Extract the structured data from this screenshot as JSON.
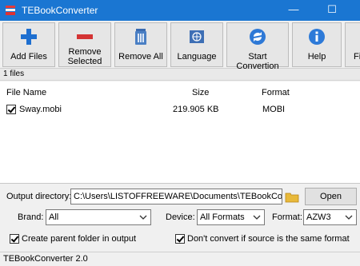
{
  "window": {
    "title": "TEBookConverter"
  },
  "toolbar": {
    "buttons": [
      {
        "label": "Add Files",
        "icon": "plus-icon"
      },
      {
        "label": "Remove\nSelected",
        "icon": "minus-icon"
      },
      {
        "label": "Remove All",
        "icon": "trash-icon"
      },
      {
        "label": "Language",
        "icon": "globe-icon"
      },
      {
        "label": "Start Convertion",
        "icon": "convert-icon"
      },
      {
        "label": "Help",
        "icon": "info-icon"
      },
      {
        "label": "Fi",
        "icon": ""
      }
    ]
  },
  "files": {
    "count_label": "1 files",
    "columns": [
      "File Name",
      "Size",
      "Format"
    ],
    "rows": [
      {
        "checked": true,
        "name": "Sway.mobi",
        "size": "219.905 KB",
        "format": "MOBI"
      }
    ]
  },
  "output": {
    "label": "Output directory:",
    "path": "C:\\Users\\LISTOFFREEWARE\\Documents\\TEBookConverter",
    "open_label": "Open"
  },
  "filters": {
    "brand_label": "Brand:",
    "brand_value": "All",
    "device_label": "Device:",
    "device_value": "All Formats",
    "format_label": "Format:",
    "format_value": "AZW3"
  },
  "options": {
    "create_parent": {
      "checked": true,
      "label": "Create parent folder in output"
    },
    "dont_convert": {
      "checked": true,
      "label": "Don't convert if source is the same format"
    }
  },
  "status": {
    "text": "TEBookConverter 2.0"
  },
  "colors": {
    "titlebar": "#1a76d2",
    "background": "#f0f0f0"
  }
}
